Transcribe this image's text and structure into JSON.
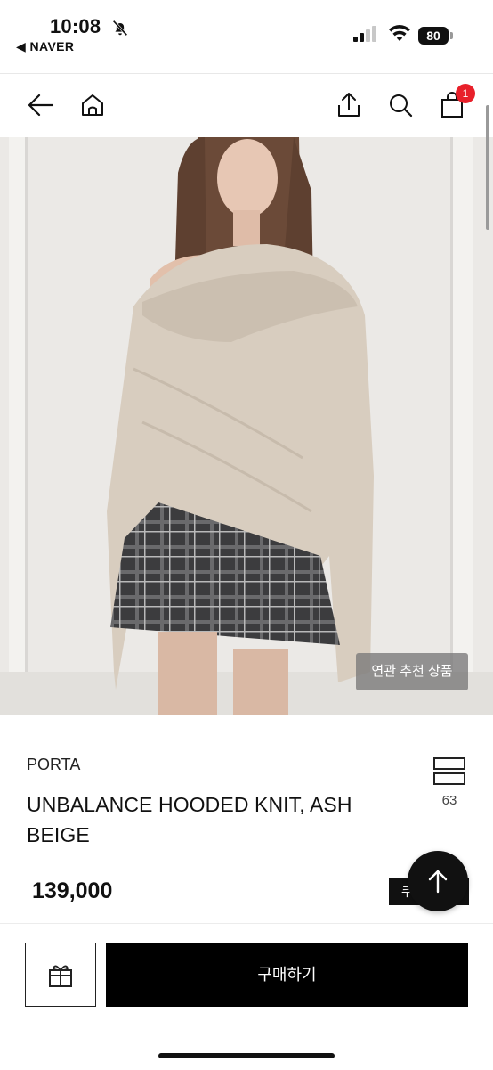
{
  "status": {
    "time": "10:08",
    "back_app": "◀ NAVER",
    "battery": "80"
  },
  "nav": {
    "cart_count": "1"
  },
  "image": {
    "related_label": "연관 추천 상품",
    "slide_progress": 0.5
  },
  "product": {
    "brand": "PORTA",
    "title": "UNBALANCE HOODED KNIT, ASH BEIGE",
    "wish_count": "63",
    "price": "139,000",
    "coupon_label": "쿠"
  },
  "bottom": {
    "buy_label": "구매하기"
  },
  "icons": [
    "back-arrow-icon",
    "home-icon",
    "share-icon",
    "search-icon",
    "cart-icon",
    "wish-icon",
    "arrow-up-icon",
    "gift-icon",
    "bell-off-icon",
    "signal-icon",
    "wifi-icon"
  ],
  "colors": {
    "badge": "#e8202a",
    "primary": "#000000"
  }
}
